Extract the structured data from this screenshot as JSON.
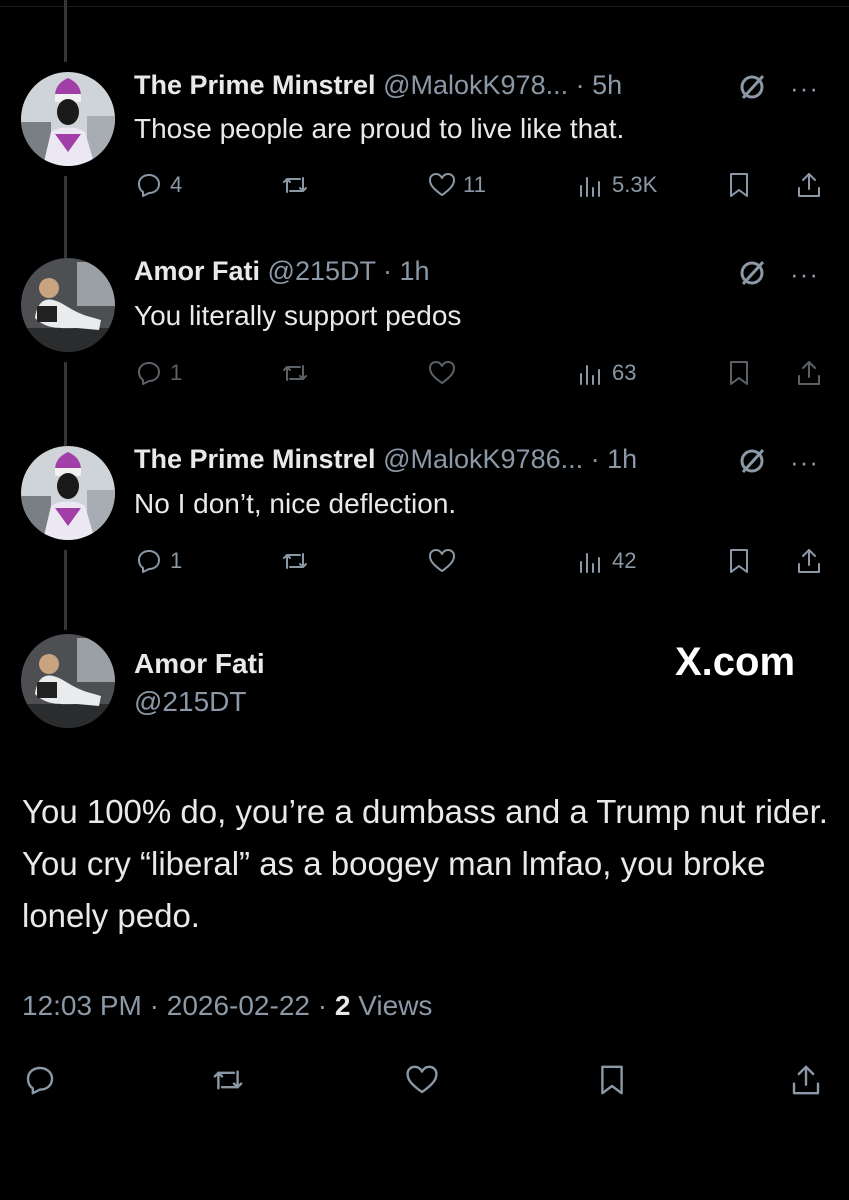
{
  "replies": [
    {
      "name": "The Prime Minstrel",
      "handle": "@MalokK978...",
      "sep": "·",
      "time": "5h",
      "text": "Those people are proud to live like that.",
      "replies": "4",
      "retweets": "",
      "likes": "11",
      "views": "5.3K"
    },
    {
      "name": "Amor Fati",
      "handle": "@215DT",
      "sep": "·",
      "time": "1h",
      "text": "You literally support pedos",
      "replies": "1",
      "retweets": "",
      "likes": "",
      "views": "63"
    },
    {
      "name": "The Prime Minstrel",
      "handle": "@MalokK9786...",
      "sep": "·",
      "time": "1h",
      "text": "No I don’t, nice deflection.",
      "replies": "1",
      "retweets": "",
      "likes": "",
      "views": "42"
    }
  ],
  "main": {
    "name": "Amor Fati",
    "handle": "@215DT",
    "watermark": "X.com",
    "text": "You 100% do, you’re a dumbass and a Trump nut rider. You cry “liberal” as a boogey man lmfao, you broke lonely pedo.",
    "time": "12:03 PM",
    "sep": "·",
    "date": "2026-02-22",
    "views_count": "2",
    "views_label": "Views"
  },
  "more_label": "···",
  "icons": [
    "reply-icon",
    "retweet-icon",
    "like-icon",
    "views-icon",
    "bookmark-icon",
    "share-icon",
    "grok-icon"
  ],
  "colors": {
    "background": "#000000",
    "text": "#e7e9ea",
    "muted": "#8b98a5",
    "thread_line": "#333639"
  }
}
